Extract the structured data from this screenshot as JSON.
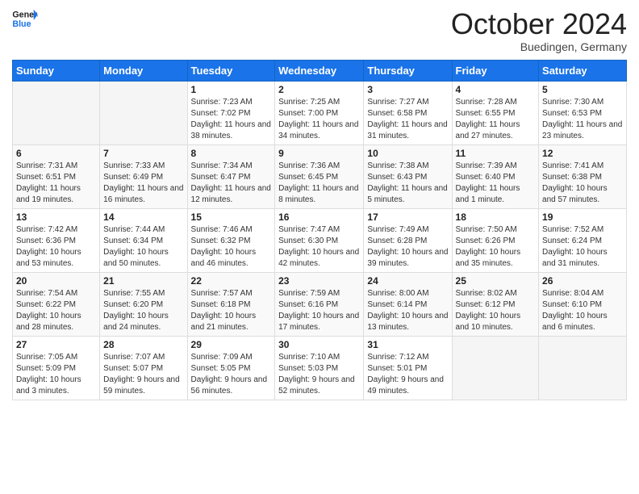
{
  "logo": {
    "line1": "General",
    "line2": "Blue"
  },
  "title": "October 2024",
  "location": "Buedingen, Germany",
  "days_header": [
    "Sunday",
    "Monday",
    "Tuesday",
    "Wednesday",
    "Thursday",
    "Friday",
    "Saturday"
  ],
  "weeks": [
    [
      {
        "day": "",
        "content": ""
      },
      {
        "day": "",
        "content": ""
      },
      {
        "day": "1",
        "content": "Sunrise: 7:23 AM\nSunset: 7:02 PM\nDaylight: 11 hours and 38 minutes."
      },
      {
        "day": "2",
        "content": "Sunrise: 7:25 AM\nSunset: 7:00 PM\nDaylight: 11 hours and 34 minutes."
      },
      {
        "day": "3",
        "content": "Sunrise: 7:27 AM\nSunset: 6:58 PM\nDaylight: 11 hours and 31 minutes."
      },
      {
        "day": "4",
        "content": "Sunrise: 7:28 AM\nSunset: 6:55 PM\nDaylight: 11 hours and 27 minutes."
      },
      {
        "day": "5",
        "content": "Sunrise: 7:30 AM\nSunset: 6:53 PM\nDaylight: 11 hours and 23 minutes."
      }
    ],
    [
      {
        "day": "6",
        "content": "Sunrise: 7:31 AM\nSunset: 6:51 PM\nDaylight: 11 hours and 19 minutes."
      },
      {
        "day": "7",
        "content": "Sunrise: 7:33 AM\nSunset: 6:49 PM\nDaylight: 11 hours and 16 minutes."
      },
      {
        "day": "8",
        "content": "Sunrise: 7:34 AM\nSunset: 6:47 PM\nDaylight: 11 hours and 12 minutes."
      },
      {
        "day": "9",
        "content": "Sunrise: 7:36 AM\nSunset: 6:45 PM\nDaylight: 11 hours and 8 minutes."
      },
      {
        "day": "10",
        "content": "Sunrise: 7:38 AM\nSunset: 6:43 PM\nDaylight: 11 hours and 5 minutes."
      },
      {
        "day": "11",
        "content": "Sunrise: 7:39 AM\nSunset: 6:40 PM\nDaylight: 11 hours and 1 minute."
      },
      {
        "day": "12",
        "content": "Sunrise: 7:41 AM\nSunset: 6:38 PM\nDaylight: 10 hours and 57 minutes."
      }
    ],
    [
      {
        "day": "13",
        "content": "Sunrise: 7:42 AM\nSunset: 6:36 PM\nDaylight: 10 hours and 53 minutes."
      },
      {
        "day": "14",
        "content": "Sunrise: 7:44 AM\nSunset: 6:34 PM\nDaylight: 10 hours and 50 minutes."
      },
      {
        "day": "15",
        "content": "Sunrise: 7:46 AM\nSunset: 6:32 PM\nDaylight: 10 hours and 46 minutes."
      },
      {
        "day": "16",
        "content": "Sunrise: 7:47 AM\nSunset: 6:30 PM\nDaylight: 10 hours and 42 minutes."
      },
      {
        "day": "17",
        "content": "Sunrise: 7:49 AM\nSunset: 6:28 PM\nDaylight: 10 hours and 39 minutes."
      },
      {
        "day": "18",
        "content": "Sunrise: 7:50 AM\nSunset: 6:26 PM\nDaylight: 10 hours and 35 minutes."
      },
      {
        "day": "19",
        "content": "Sunrise: 7:52 AM\nSunset: 6:24 PM\nDaylight: 10 hours and 31 minutes."
      }
    ],
    [
      {
        "day": "20",
        "content": "Sunrise: 7:54 AM\nSunset: 6:22 PM\nDaylight: 10 hours and 28 minutes."
      },
      {
        "day": "21",
        "content": "Sunrise: 7:55 AM\nSunset: 6:20 PM\nDaylight: 10 hours and 24 minutes."
      },
      {
        "day": "22",
        "content": "Sunrise: 7:57 AM\nSunset: 6:18 PM\nDaylight: 10 hours and 21 minutes."
      },
      {
        "day": "23",
        "content": "Sunrise: 7:59 AM\nSunset: 6:16 PM\nDaylight: 10 hours and 17 minutes."
      },
      {
        "day": "24",
        "content": "Sunrise: 8:00 AM\nSunset: 6:14 PM\nDaylight: 10 hours and 13 minutes."
      },
      {
        "day": "25",
        "content": "Sunrise: 8:02 AM\nSunset: 6:12 PM\nDaylight: 10 hours and 10 minutes."
      },
      {
        "day": "26",
        "content": "Sunrise: 8:04 AM\nSunset: 6:10 PM\nDaylight: 10 hours and 6 minutes."
      }
    ],
    [
      {
        "day": "27",
        "content": "Sunrise: 7:05 AM\nSunset: 5:09 PM\nDaylight: 10 hours and 3 minutes."
      },
      {
        "day": "28",
        "content": "Sunrise: 7:07 AM\nSunset: 5:07 PM\nDaylight: 9 hours and 59 minutes."
      },
      {
        "day": "29",
        "content": "Sunrise: 7:09 AM\nSunset: 5:05 PM\nDaylight: 9 hours and 56 minutes."
      },
      {
        "day": "30",
        "content": "Sunrise: 7:10 AM\nSunset: 5:03 PM\nDaylight: 9 hours and 52 minutes."
      },
      {
        "day": "31",
        "content": "Sunrise: 7:12 AM\nSunset: 5:01 PM\nDaylight: 9 hours and 49 minutes."
      },
      {
        "day": "",
        "content": ""
      },
      {
        "day": "",
        "content": ""
      }
    ]
  ]
}
